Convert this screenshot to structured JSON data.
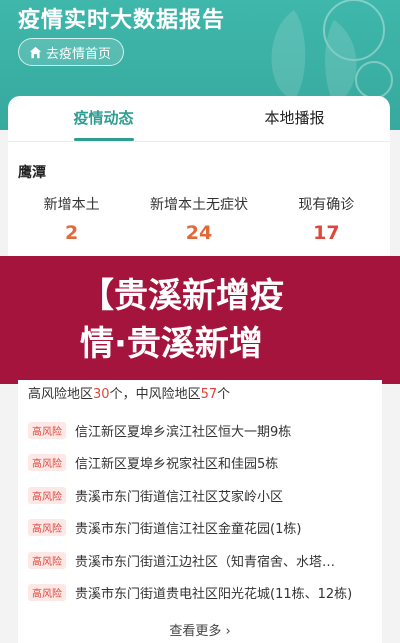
{
  "header": {
    "title": "疫情实时大数据报告",
    "home_button_label": "去疫情首页"
  },
  "tabs": [
    {
      "label": "疫情动态",
      "active": true
    },
    {
      "label": "本地播报",
      "active": false
    }
  ],
  "city": "鹰潭",
  "stats": [
    {
      "label": "新增本土",
      "value": "2"
    },
    {
      "label": "新增本土无症状",
      "value": "24"
    },
    {
      "label": "现有确诊",
      "value": "17"
    }
  ],
  "banner": {
    "line1": "【贵溪新增疫",
    "line2": "情·贵溪新增"
  },
  "risk": {
    "high_label": "高风险地区",
    "high_count": "30",
    "unit1": "个，",
    "mid_label": "中风险地区",
    "mid_count": "57",
    "unit2": "个",
    "badge": "高风险",
    "items": [
      "信江新区夏埠乡滨江社区恒大一期9栋",
      "信江新区夏埠乡祝家社区和佳园5栋",
      "贵溪市东门街道信江社区艾家岭小区",
      "贵溪市东门街道信江社区金童花园(1栋)",
      "贵溪市东门街道江边社区（知青宿舍、水塔…",
      "贵溪市东门街道贵电社区阳光花城(11栋、12栋)"
    ],
    "see_more": "查看更多"
  },
  "colors": {
    "teal": "#37a99e",
    "accent": "#2f9e92",
    "stat_value": "#e06a3a",
    "banner": "#a5143c",
    "risk_red": "#e0463c"
  }
}
